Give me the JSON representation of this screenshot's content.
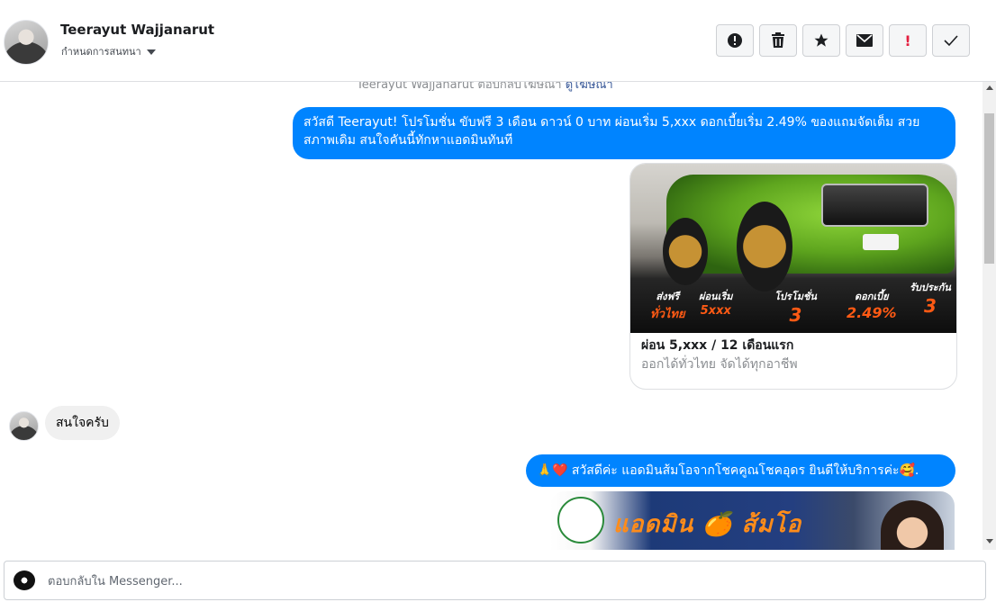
{
  "header": {
    "name": "Teerayut Wajjanarut",
    "status": "กำหนดการสนทนา",
    "actions": [
      "spam-icon",
      "trash-icon",
      "star-icon",
      "envelope-icon",
      "follow-up-icon",
      "check-icon"
    ],
    "follow_up_glyph": "!"
  },
  "chat": {
    "partial_line": "Teerayut Wajjanarut ตอบกลับโฆษณา",
    "partial_link": "ดูโฆษณา",
    "messages": [
      {
        "from": "page",
        "text": "สวัสดี Teerayut! โปรโมชั่น ขับฟรี 3 เดือน ดาวน์ 0 บาท ผ่อนเริ่ม 5,xxx  ดอกเบี้ยเริ่ม 2.49% ของแถมจัดเต็ม สวย สภาพเดิม สนใจคันนี้ทักหาแอดมินทันที"
      },
      {
        "from": "page",
        "card": {
          "title": "ผ่อน 5,xxx / 12 เดือนแรก",
          "subtitle": "ออกได้ทั่วไทย จัดได้ทุกอาชีพ",
          "promo": [
            {
              "label": "ส่งฟรี",
              "value": "ทั่วไทย"
            },
            {
              "label": "ผ่อนเริ่ม",
              "value": "5xxx"
            },
            {
              "label": "โปรโมชั่น",
              "value": "3"
            },
            {
              "label": "ดอกเบี้ย",
              "value": "2.49%"
            },
            {
              "label": "รับประกัน",
              "value": "3"
            }
          ]
        }
      },
      {
        "from": "user",
        "text": "สนใจครับ"
      },
      {
        "from": "page",
        "emoji_left": "🙏❤️",
        "text": " สวัสดีค่ะ แอดมินส้มโอจากโชคคูณโชคอุดร ยินดีให้บริการค่ะ ",
        "emoji_right": "🥰."
      },
      {
        "from": "page",
        "banner_text": "แอดมิน 🍊 ส้มโอ"
      }
    ]
  },
  "composer": {
    "placeholder": "ตอบกลับใน Messenger..."
  },
  "colors": {
    "outgoing_bubble": "#0084ff",
    "incoming_bubble": "#f0f0f0",
    "follow_up_red": "#e41e3f",
    "promo_orange": "#ff5a14"
  }
}
